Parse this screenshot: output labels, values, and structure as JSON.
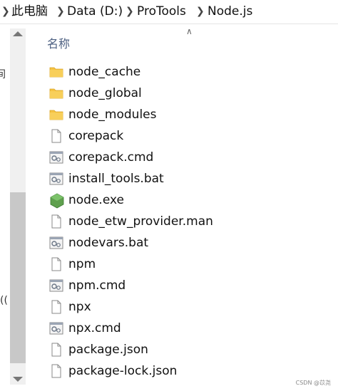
{
  "breadcrumb": {
    "items": [
      {
        "label": "此电脑"
      },
      {
        "label": "Data (D:)"
      },
      {
        "label": "ProTools"
      },
      {
        "label": "Node.js"
      }
    ]
  },
  "left_nav": {
    "partial_glyph_1": "间",
    "partial_glyph_2": "(("
  },
  "columns": {
    "name_header": "名称"
  },
  "files": [
    {
      "name": "node_cache",
      "icon": "folder-icon"
    },
    {
      "name": "node_global",
      "icon": "folder-icon"
    },
    {
      "name": "node_modules",
      "icon": "folder-icon"
    },
    {
      "name": "corepack",
      "icon": "file-icon"
    },
    {
      "name": "corepack.cmd",
      "icon": "script-icon"
    },
    {
      "name": "install_tools.bat",
      "icon": "script-icon"
    },
    {
      "name": "node.exe",
      "icon": "node-exe-icon"
    },
    {
      "name": "node_etw_provider.man",
      "icon": "file-icon"
    },
    {
      "name": "nodevars.bat",
      "icon": "script-icon"
    },
    {
      "name": "npm",
      "icon": "file-icon"
    },
    {
      "name": "npm.cmd",
      "icon": "script-icon"
    },
    {
      "name": "npx",
      "icon": "file-icon"
    },
    {
      "name": "npx.cmd",
      "icon": "script-icon"
    },
    {
      "name": "package.json",
      "icon": "file-icon"
    },
    {
      "name": "package-lock.json",
      "icon": "file-icon"
    }
  ],
  "watermark": "CSDN @苡尧",
  "colors": {
    "folder": "#f6c343",
    "node_green": "#5fa04e",
    "header_text": "#4d6082"
  }
}
